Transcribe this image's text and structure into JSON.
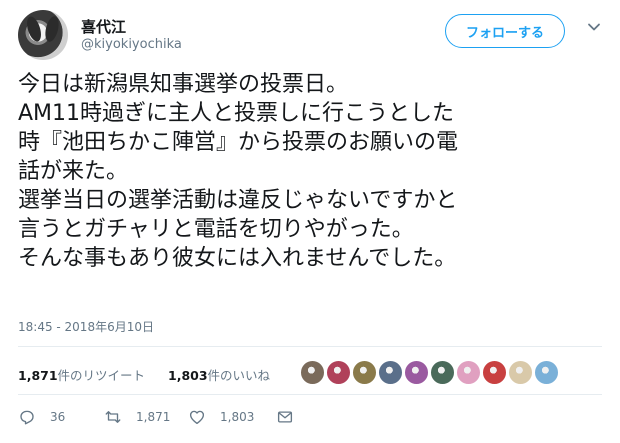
{
  "tweet": {
    "author_name": "喜代江",
    "author_handle": "@kiyokiyochika",
    "follow_label": "フォローする",
    "text_lines": [
      "今日は新潟県知事選挙の投票日。",
      "AM11時過ぎに主人と投票しに行こうとした",
      "時『池田ちかこ陣営』から投票のお願いの電",
      "話が来た。",
      "選挙当日の選挙活動は違反じゃないですかと",
      "言うとガチャリと電話を切りやがった。",
      "そんな事もあり彼女には入れませんでした。"
    ],
    "timestamp": "18:45 - 2018年6月10日"
  },
  "stats": {
    "retweets_count": "1,871",
    "retweets_label": "件のリツイート",
    "likes_count": "1,803",
    "likes_label": "件のいいね"
  },
  "actions": {
    "reply_count": "36",
    "retweet_count": "1,871",
    "like_count": "1,803"
  },
  "likers": [
    {
      "color": "#7a6a5a"
    },
    {
      "color": "#b0415a"
    },
    {
      "color": "#8a7a4a"
    },
    {
      "color": "#5a6f8a"
    },
    {
      "color": "#9a5aa0"
    },
    {
      "color": "#4a6a5a"
    },
    {
      "color": "#e0a0c0"
    },
    {
      "color": "#c84040"
    },
    {
      "color": "#d9c9a9"
    },
    {
      "color": "#7ab0d8"
    }
  ],
  "colors": {
    "accent": "#1da1f2",
    "text_primary": "#14171a",
    "text_secondary": "#657786",
    "divider": "#e6ecf0"
  }
}
